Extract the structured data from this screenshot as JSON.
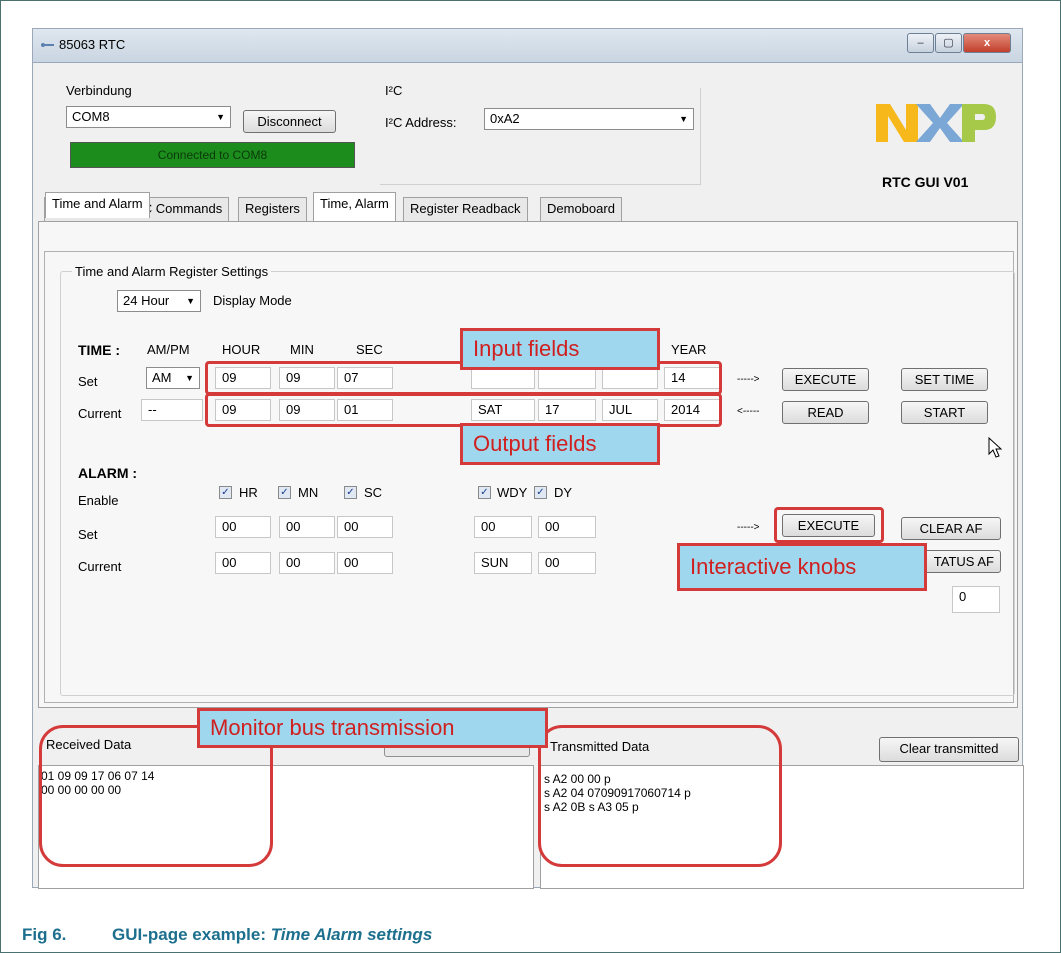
{
  "window": {
    "title": "85063 RTC",
    "minimize_label": "–",
    "maximize_label": "▢",
    "close_label": "x"
  },
  "connection": {
    "group_label": "Verbindung",
    "port_value": "COM8",
    "disconnect_label": "Disconnect",
    "status_text": "Connected to COM8",
    "status_color": "#1c8c1c"
  },
  "i2c": {
    "group_label": "I²C",
    "address_label": "I²C Address:",
    "address_value": "0xA2"
  },
  "brand": {
    "logo_text": "NXP",
    "version": "RTC GUI V01"
  },
  "tabs": [
    {
      "label": "General USB-I2C Commands"
    },
    {
      "label": "Registers"
    },
    {
      "label": "Time, Alarm"
    },
    {
      "label": "Register Readback"
    },
    {
      "label": "Demoboard"
    }
  ],
  "subtab": {
    "label": "Time and Alarm"
  },
  "settings": {
    "group_label": "Time and Alarm Register Settings",
    "display_mode_value": "24 Hour",
    "display_mode_label": "Display Mode"
  },
  "time": {
    "section_label": "TIME :",
    "headers": {
      "ampm": "AM/PM",
      "hour": "HOUR",
      "min": "MIN",
      "sec": "SEC",
      "year": "YEAR"
    },
    "set_label": "Set",
    "current_label": "Current",
    "set": {
      "ampm": "AM",
      "hour": "09",
      "min": "09",
      "sec": "07",
      "year": "14"
    },
    "current": {
      "ampm": "--",
      "hour": "09",
      "min": "09",
      "sec": "01",
      "weekday": "SAT",
      "day": "17",
      "month": "JUL",
      "year": "2014"
    },
    "arrow_set": "----->",
    "arrow_read": "<-----",
    "execute_label": "EXECUTE",
    "set_time_label": "SET TIME",
    "read_label": "READ",
    "start_label": "START"
  },
  "alarm": {
    "section_label": "ALARM :",
    "enable_label": "Enable",
    "set_label": "Set",
    "current_label": "Current",
    "checks": {
      "hr": "HR",
      "mn": "MN",
      "sc": "SC",
      "wdy": "WDY",
      "dy": "DY"
    },
    "set": {
      "hr": "00",
      "mn": "00",
      "sc": "00",
      "wdy": "00",
      "dy": "00"
    },
    "current": {
      "hr": "00",
      "mn": "00",
      "sc": "00",
      "wdy": "SUN",
      "dy": "00"
    },
    "arrow_set": "----->",
    "execute_label": "EXECUTE",
    "clear_af_label": "CLEAR AF",
    "status_af_label": "TATUS AF",
    "status_value": "0"
  },
  "received": {
    "label": "Received Data",
    "line1": "01 09 09 17 06 07 14",
    "line2": "00 00 00 00 00"
  },
  "transmitted": {
    "label": "Transmitted Data",
    "clear_label": "Clear transmitted",
    "line1": "s A2 00 00 p",
    "line2": "s A2 04 07090917060714 p",
    "line3": "s A2 0B s A3 05 p"
  },
  "callouts": {
    "input_fields": "Input fields",
    "output_fields": "Output fields",
    "interactive_knobs": "Interactive knobs",
    "monitor_bus": "Monitor bus transmission"
  },
  "caption": {
    "prefix": "Fig 6.",
    "text": "GUI-page example: ",
    "italic": "Time Alarm settings"
  }
}
